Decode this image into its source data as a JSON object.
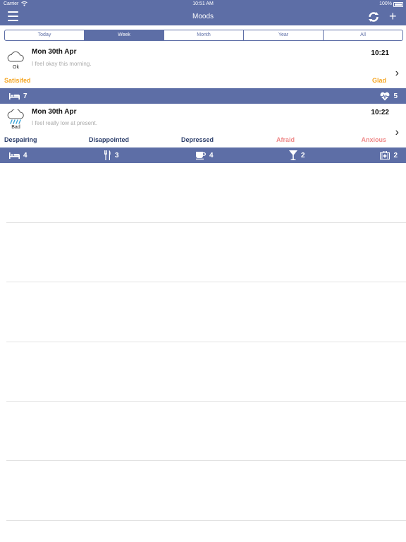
{
  "status_bar": {
    "carrier": "Carrier",
    "time": "10:51 AM",
    "battery": "100%"
  },
  "nav": {
    "title": "Moods"
  },
  "segments": [
    {
      "label": "Today",
      "active": false
    },
    {
      "label": "Week",
      "active": true
    },
    {
      "label": "Month",
      "active": false
    },
    {
      "label": "Year",
      "active": false
    },
    {
      "label": "All",
      "active": false
    }
  ],
  "entries": [
    {
      "mood": "Ok",
      "weather_icon": "cloud-icon",
      "date": "Mon 30th Apr",
      "time": "10:21",
      "note": "I feel okay this morning.",
      "feelings": [
        {
          "label": "Satisifed",
          "color": "#f5a623"
        },
        {
          "label": "Glad",
          "color": "#f5a623"
        }
      ],
      "stats": [
        {
          "icon": "bed-icon",
          "value": "7"
        },
        {
          "icon": "heart-rate-icon",
          "value": "5"
        }
      ]
    },
    {
      "mood": "Bad",
      "weather_icon": "rain-cloud-icon",
      "date": "Mon 30th Apr",
      "time": "10:22",
      "note": "I feel really low at present.",
      "feelings": [
        {
          "label": "Despairing",
          "color": "#2c3e6b"
        },
        {
          "label": "Disappointed",
          "color": "#2c3e6b"
        },
        {
          "label": "Depressed",
          "color": "#2c3e6b"
        },
        {
          "label": "Afraid",
          "color": "#ef8b8b"
        },
        {
          "label": "Anxious",
          "color": "#ef8b8b"
        }
      ],
      "stats": [
        {
          "icon": "bed-icon",
          "value": "4"
        },
        {
          "icon": "fork-knife-icon",
          "value": "3"
        },
        {
          "icon": "coffee-icon",
          "value": "4"
        },
        {
          "icon": "cocktail-icon",
          "value": "2"
        },
        {
          "icon": "medical-kit-icon",
          "value": "2"
        }
      ]
    }
  ]
}
